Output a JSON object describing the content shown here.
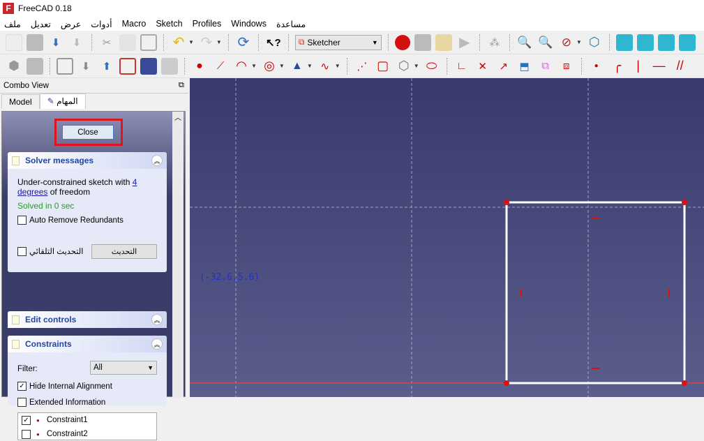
{
  "window": {
    "title": "FreeCAD 0.18",
    "logo": "FC"
  },
  "menu": [
    "ملف",
    "تعديل",
    "عرض",
    "أدوات",
    "Macro",
    "Sketch",
    "Profiles",
    "Windows",
    "مساعدة"
  ],
  "toolbar1": {
    "workbench": "Sketcher"
  },
  "combo": {
    "title": "Combo View",
    "tabs": [
      "Model",
      "المهام"
    ],
    "close": "Close"
  },
  "solver": {
    "title": "Solver messages",
    "msg_prefix": "Under-constrained sketch with ",
    "link1": "4",
    "link2": "degrees",
    "msg_suffix": " of freedom",
    "solved": "Solved in 0 sec",
    "auto_remove": "Auto Remove Redundants",
    "auto_update": "التحديث التلقائي",
    "update_button": "التحديث"
  },
  "edit_controls": {
    "title": "Edit controls"
  },
  "constraints": {
    "title": "Constraints",
    "filter_label": "Filter:",
    "filter_value": "All",
    "hide_internal": "Hide Internal Alignment",
    "hide_internal_checked": true,
    "extended": "Extended Information",
    "extended_checked": false,
    "items": [
      {
        "name": "Constraint1",
        "checked": true
      },
      {
        "name": "Constraint2",
        "checked": false
      }
    ]
  },
  "canvas": {
    "cursor_coords": "(-32.6,5.6)"
  },
  "colors": {
    "accent_red": "#e0141c",
    "solved_green": "#2a9a2a",
    "link_blue": "#1a1aa6"
  }
}
